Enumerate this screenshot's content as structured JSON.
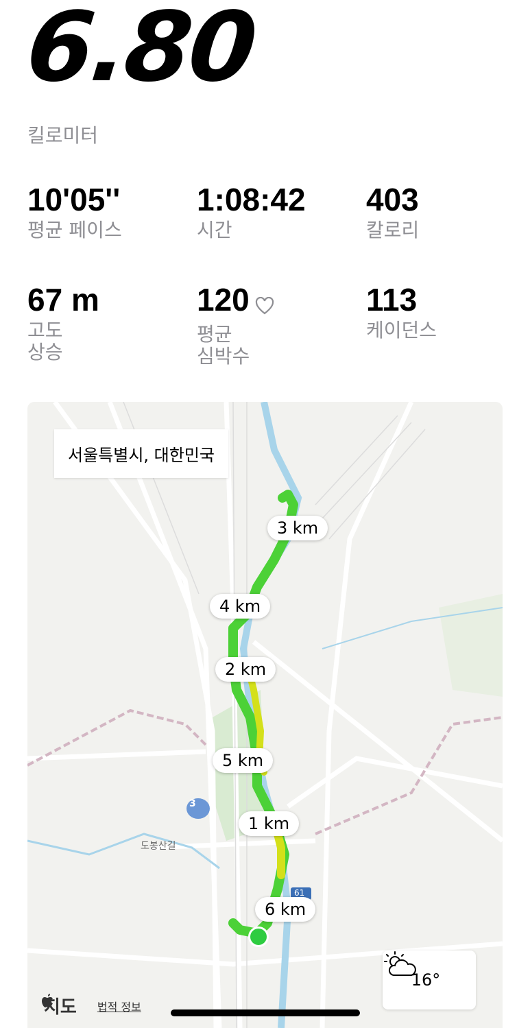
{
  "summary": {
    "distance": "6.80",
    "distance_unit": "킬로미터"
  },
  "stats": [
    {
      "value": "10'05''",
      "label": "평균 페이스"
    },
    {
      "value": "1:08:42",
      "label": "시간"
    },
    {
      "value": "403",
      "label": "칼로리"
    },
    {
      "value": "67 m",
      "label": "고도\n상승"
    },
    {
      "value": "120",
      "label": "평균\n심박수",
      "icon": "heart-outline-icon"
    },
    {
      "value": "113",
      "label": "케이던스"
    }
  ],
  "map": {
    "location": "서울특별시, 대한민국",
    "km_markers": [
      "3 km",
      "4 km",
      "2 km",
      "5 km",
      "1 km",
      "6 km"
    ],
    "road_labels": [
      "도봉산길",
      "3",
      "61"
    ],
    "weather": {
      "temp": "16°",
      "icon": "partly-cloudy-icon"
    },
    "attribution": {
      "maps": "지도",
      "legal": "법적 정보"
    },
    "route_colors": {
      "green": "#4cd137",
      "yellow": "#d4e01a",
      "river": "#a8d4ea"
    }
  }
}
